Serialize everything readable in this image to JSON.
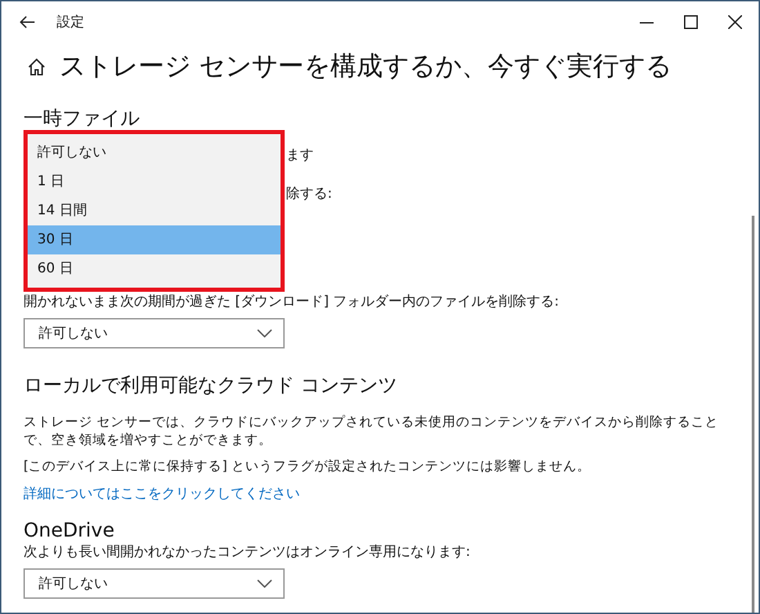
{
  "window": {
    "title": "設定"
  },
  "heading": "ストレージ センサーを構成するか、今すぐ実行する",
  "temp_files": {
    "title": "一時ファイル",
    "partial_lines": [
      "ます",
      "除する:"
    ],
    "downloads_label": "開かれないまま次の期間が過ぎた [ダウンロード] フォルダー内のファイルを削除する:",
    "downloads_value": "許可しない",
    "popup": [
      {
        "label": "許可しない",
        "selected": false
      },
      {
        "label": "1 日",
        "selected": false
      },
      {
        "label": "14 日間",
        "selected": false
      },
      {
        "label": "30 日",
        "selected": true
      },
      {
        "label": "60 日",
        "selected": false
      }
    ]
  },
  "cloud": {
    "title": "ローカルで利用可能なクラウド コンテンツ",
    "lines": [
      "ストレージ センサーでは、クラウドにバックアップされている未使用のコンテンツをデバイスから削除することで、空き領域を増やすことができます。",
      "[このデバイス上に常に保持する] というフラグが設定されたコンテンツには影響しません。"
    ],
    "link": "詳細についてはここをクリックしてください"
  },
  "onedrive": {
    "title": "OneDrive",
    "label": "次よりも長い間開かれなかったコンテンツはオンライン専用になります:",
    "value": "許可しない"
  }
}
